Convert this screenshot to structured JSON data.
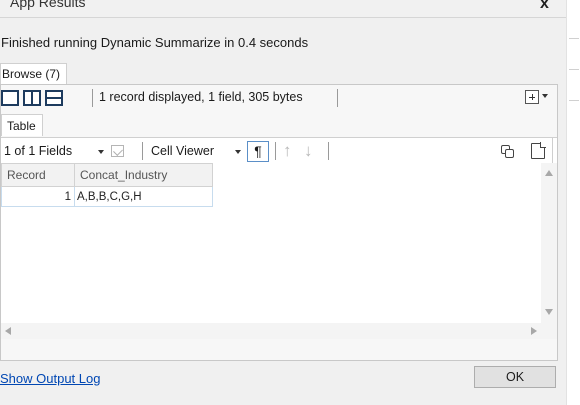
{
  "window": {
    "title": "App Results",
    "close_glyph": "x"
  },
  "status_message": "Finished running Dynamic Summarize in 0.4 seconds",
  "browse_tab": {
    "label": "Browse (7)"
  },
  "view_toolbar": {
    "record_info": "1 record displayed, 1 field, 305 bytes",
    "icons": [
      "single-view-icon",
      "split-view-icon",
      "horizontal-split-icon",
      "add-view-icon"
    ]
  },
  "table_tab": {
    "label": "Table"
  },
  "table_toolbar": {
    "fields_label": "1 of 1 Fields",
    "cell_viewer_label": "Cell Viewer",
    "pilcrow": "¶",
    "arrow_up": "↑",
    "arrow_down": "↓",
    "icons": [
      "checkbox-icon",
      "copy-icon",
      "page-icon"
    ]
  },
  "grid": {
    "columns": [
      "Record",
      "Concat_Industry"
    ],
    "rows": [
      {
        "record": "1",
        "value": "A,B,B,C,G,H"
      }
    ]
  },
  "footer": {
    "show_log_label": "Show Output Log",
    "ok_label": "OK"
  },
  "colors": {
    "link": "#0047b3",
    "icon_dark": "#1d3b5e",
    "row_border": "#c7dcee"
  }
}
